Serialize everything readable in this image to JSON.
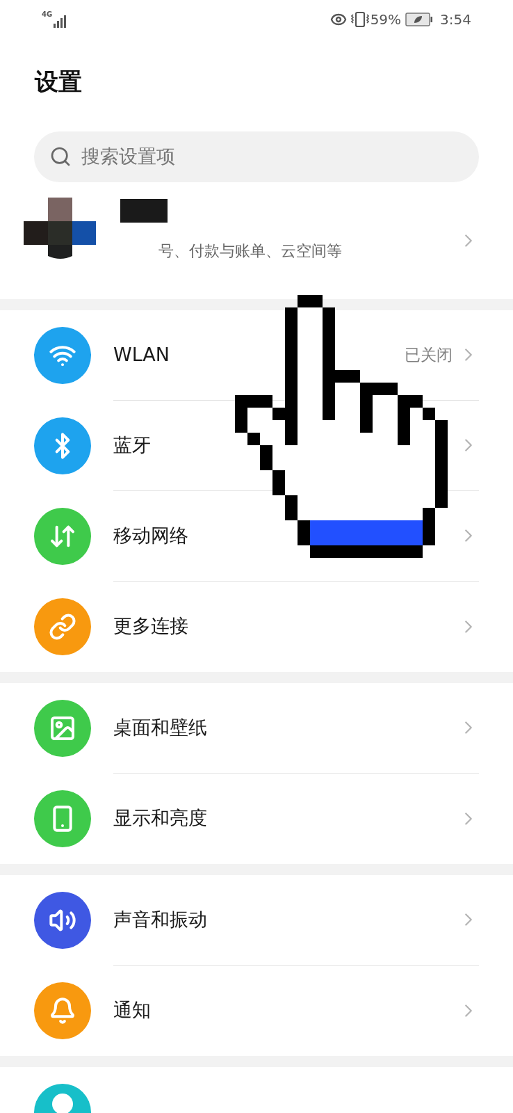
{
  "status_bar": {
    "network": "4G",
    "battery": "59%",
    "time": "3:54"
  },
  "title": "设置",
  "search": {
    "placeholder": "搜索设置项"
  },
  "account": {
    "subtitle": "号、付款与账单、云空间等"
  },
  "groups": [
    {
      "items": [
        {
          "label": "WLAN",
          "status": "已关闭",
          "color": "#1ea3ee"
        },
        {
          "label": "蓝牙",
          "color": "#1ea3ee"
        },
        {
          "label": "移动网络",
          "color": "#3fca4b"
        },
        {
          "label": "更多连接",
          "color": "#f8990f"
        }
      ]
    },
    {
      "items": [
        {
          "label": "桌面和壁纸",
          "color": "#3fca4b"
        },
        {
          "label": "显示和亮度",
          "color": "#3fca4b"
        }
      ]
    },
    {
      "items": [
        {
          "label": "声音和振动",
          "color": "#3f58e3"
        },
        {
          "label": "通知",
          "color": "#f8990f"
        }
      ]
    }
  ],
  "partial_row": {
    "color": "#17bfc9"
  }
}
